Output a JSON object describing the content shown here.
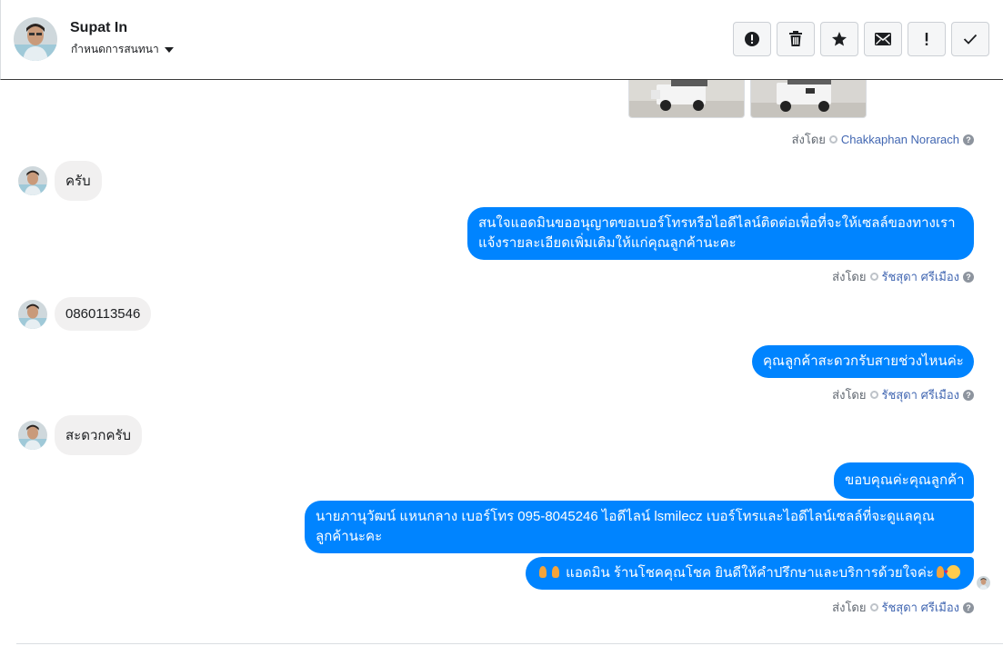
{
  "header": {
    "contact_name": "Supat In",
    "assign_label": "กำหนดการสนทนา",
    "actions": [
      "mark-spam",
      "delete",
      "star",
      "mark-unread",
      "follow-up",
      "mark-done"
    ]
  },
  "colors": {
    "bubble_out": "#0084ff",
    "bubble_in": "#f1f0f0",
    "header_border": "#3a3a3a"
  },
  "thread": {
    "sent_by_prefix": "ส่งโดย",
    "photo_sender": "Chakkaphan Norarach",
    "messages": [
      {
        "direction": "in",
        "text": "ครับ"
      },
      {
        "direction": "out",
        "text": "สนใจแอดมินขออนุญาตขอเบอร์โทรหรือไอดีไลน์ติดต่อเพื่อที่จะให้เซลล์ของทางเราแจ้งรายละเอียดเพิ่มเติมให้แก่คุณลูกค้านะคะ",
        "sent_by": "รัชสุดา ศรีเมือง"
      },
      {
        "direction": "in",
        "text": "0860113546"
      },
      {
        "direction": "out",
        "text": "คุณลูกค้าสะดวกรับสายช่วงไหนค่ะ",
        "sent_by": "รัชสุดา ศรีเมือง"
      },
      {
        "direction": "in",
        "text": "สะดวกครับ"
      },
      {
        "direction": "out",
        "text": "ขอบคุณค่ะคุณลูกค้า"
      },
      {
        "direction": "out",
        "text": "นายภานุวัฒน์ แหนกลาง เบอร์โทร 095-8045246 ไอดีไลน์ lsmilecz   เบอร์โทรและไอดีไลน์เซลล์ที่จะดูแลคุณลูกค้านะคะ"
      },
      {
        "direction": "out",
        "text": "แอดมิน ร้านโชคคุณโชค ยินดีให้คำปรึกษาและบริการด้วยใจค่ะ",
        "sent_by": "รัชสุดา ศรีเมือง"
      }
    ]
  }
}
